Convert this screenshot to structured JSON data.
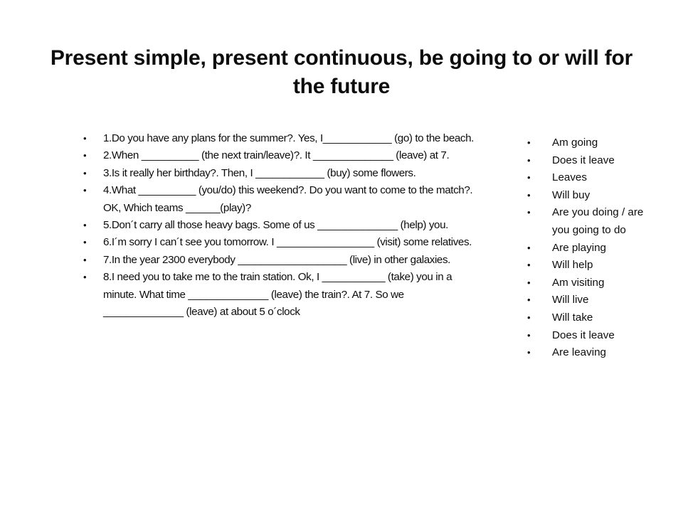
{
  "slide": {
    "title": "Present simple, present continuous, be going to or will for the future",
    "background_color": "#ffffff",
    "text_color": "#0d0d0d"
  },
  "exercises": {
    "bullet_glyph": "•",
    "items": [
      "1.Do you have any plans for the summer?. Yes, I____________ (go) to the beach.",
      "2.When __________ (the next train/leave)?. It ______________ (leave) at 7.",
      "3.Is it really her birthday?. Then, I ____________ (buy) some flowers.",
      "4.What __________ (you/do) this weekend?. Do you want to come to the match?. OK, Which teams ______(play)?",
      "5.Don´t carry all those heavy bags. Some of us ______________ (help) you.",
      "6.I´m sorry I can´t see you tomorrow. I _________________ (visit) some relatives.",
      "7.In the year 2300 everybody ___________________ (live) in other galaxies.",
      "8.I need you to take me to the train station. Ok, I ___________ (take) you in a minute.  What time ______________ (leave) the train?. At 7. So we ______________ (leave) at about 5 o´clock"
    ]
  },
  "answers": {
    "bullet_glyph": "•",
    "items": [
      "Am going",
      "Does it leave",
      "Leaves",
      "Will buy",
      "Are you doing / are you going to do",
      "Are playing",
      "Will help",
      "Am visiting",
      "Will live",
      "Will take",
      "Does it leave",
      "Are leaving"
    ]
  }
}
